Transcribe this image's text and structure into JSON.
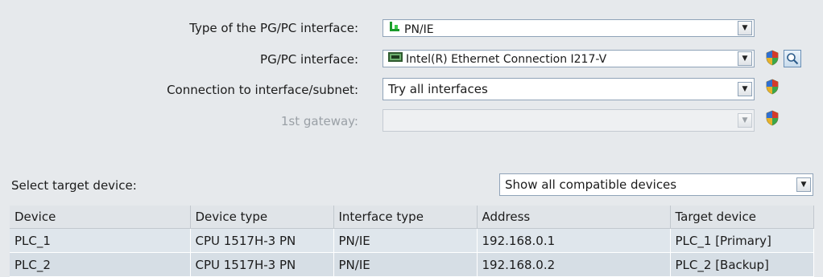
{
  "form": {
    "pgpc_type_label": "Type of the PG/PC interface:",
    "pgpc_type_value": "PN/IE",
    "pgpc_interface_label": "PG/PC interface:",
    "pgpc_interface_value": "Intel(R) Ethernet Connection I217-V",
    "connection_label": "Connection to interface/subnet:",
    "connection_value": "Try all interfaces",
    "gateway_label": "1st gateway:",
    "gateway_value": ""
  },
  "target": {
    "label": "Select target device:",
    "filter_value": "Show all compatible devices"
  },
  "table": {
    "headers": [
      "Device",
      "Device type",
      "Interface type",
      "Address",
      "Target device"
    ],
    "rows": [
      [
        "PLC_1",
        "CPU 1517H-3 PN",
        "PN/IE",
        "192.168.0.1",
        "PLC_1 [Primary]"
      ],
      [
        "PLC_2",
        "CPU 1517H-3 PN",
        "PN/IE",
        "192.168.0.2",
        "PLC_2 [Backup]"
      ]
    ]
  },
  "icons": {
    "pnie": "network-plug-icon",
    "nic": "network-card-icon",
    "shield": "security-shield-icon",
    "search": "magnifier-icon"
  },
  "colors": {
    "background": "#e6e9ec",
    "border": "#8fa3b8",
    "header_bg": "#e0e4e8",
    "row_bg": "#dfe6ec"
  }
}
